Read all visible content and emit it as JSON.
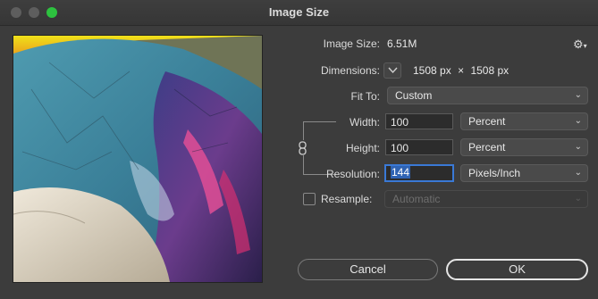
{
  "window": {
    "title": "Image Size"
  },
  "image_size": {
    "label": "Image Size:",
    "value": "6.51M"
  },
  "dimensions": {
    "label": "Dimensions:",
    "width": "1508",
    "width_unit": "px",
    "times": "×",
    "height": "1508",
    "height_unit": "px"
  },
  "fit_to": {
    "label": "Fit To:",
    "value": "Custom"
  },
  "width": {
    "label": "Width:",
    "value": "100",
    "unit": "Percent"
  },
  "height": {
    "label": "Height:",
    "value": "100",
    "unit": "Percent"
  },
  "resolution": {
    "label": "Resolution:",
    "value": "144",
    "unit": "Pixels/Inch"
  },
  "resample": {
    "label": "Resample:",
    "value": "Automatic",
    "checked": false
  },
  "buttons": {
    "cancel": "Cancel",
    "ok": "OK"
  },
  "icons": {
    "gear": "gear-icon",
    "dimensions_toggle": "chevron-down-icon",
    "link": "chain-link-icon"
  },
  "colors": {
    "window_bg": "#3c3c3c",
    "focus": "#3a79d6",
    "maximize": "#2dc23f"
  }
}
